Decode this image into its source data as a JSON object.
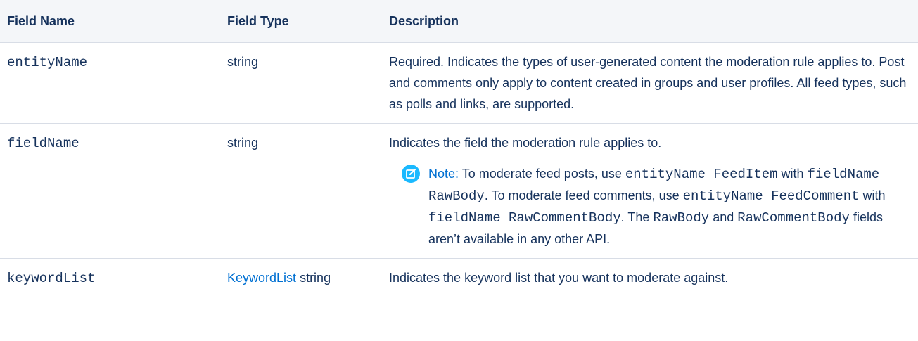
{
  "headers": {
    "field_name": "Field Name",
    "field_type": "Field Type",
    "description": "Description"
  },
  "rows": [
    {
      "name": "entityName",
      "type": "string",
      "description": "Required. Indicates the types of user-generated content the moderation rule applies to. Post and comments only apply to content created in groups and user profiles. All feed types, such as polls and links, are supported."
    },
    {
      "name": "fieldName",
      "type": "string",
      "description": "Indicates the field the moderation rule applies to.",
      "note": {
        "label": "Note:",
        "t1": "To moderate feed posts, use",
        "c1": "entityName FeedItem",
        "t2": "with",
        "c2": "fieldName RawBody",
        "t3": ". To moderate feed comments, use",
        "c3": "entityName FeedComment",
        "t4": "with",
        "c4": "fieldName RawCommentBody",
        "t5": ". The",
        "c5": "RawBody",
        "t6": "and",
        "c6": "RawCommentBody",
        "t7": "fields aren’t available in any other API."
      }
    },
    {
      "name": "keywordList",
      "type_link": "KeywordList",
      "type": "string",
      "description": "Indicates the keyword list that you want to moderate against."
    }
  ],
  "colors": {
    "text": "#16325c",
    "link": "#0070d2",
    "note_icon": "#1ab9ff",
    "header_bg": "#f4f6f9",
    "border": "#d8dde6"
  },
  "icons": {
    "note": "note-edit-icon"
  }
}
